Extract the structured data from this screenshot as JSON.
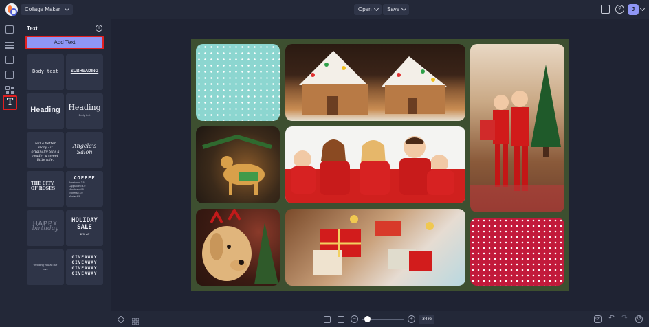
{
  "header": {
    "app_name": "Collage Maker",
    "open_label": "Open",
    "save_label": "Save",
    "user_initial": "J"
  },
  "panel": {
    "title": "Text",
    "add_button": "Add Text",
    "tiles": [
      {
        "text": "Body text"
      },
      {
        "text": "SUBHEADING"
      },
      {
        "text": "Heading"
      },
      {
        "text": "Heading",
        "sub": "Body text"
      },
      {
        "text": "tell a better story · it originally tells a reader a sweet little tale."
      },
      {
        "text": "Angela's Salon",
        "sub": "·······"
      },
      {
        "text": "THE CITY OF ROSES"
      },
      {
        "text": "COFFEE",
        "rows": [
          "Americano 3.5",
          "Cappuccino 4.0",
          "Macchiato 4.5",
          "Espresso 3.0",
          "Mocha 4.5"
        ]
      },
      {
        "text": "HAPPY",
        "sub": "birthday"
      },
      {
        "text": "HOLIDAY SALE",
        "sub": "30% off"
      },
      {
        "text": "wedding you all our love"
      },
      {
        "text": "GIVEAWAY"
      }
    ]
  },
  "zoom": {
    "value": "34%",
    "level": 0.14
  },
  "colors": {
    "accent": "#8f96f5",
    "highlight": "#e02020",
    "canvas_bg": "#3d4f30",
    "teal_pattern": "#8cd6d0",
    "red_pattern": "#c21a3b"
  }
}
